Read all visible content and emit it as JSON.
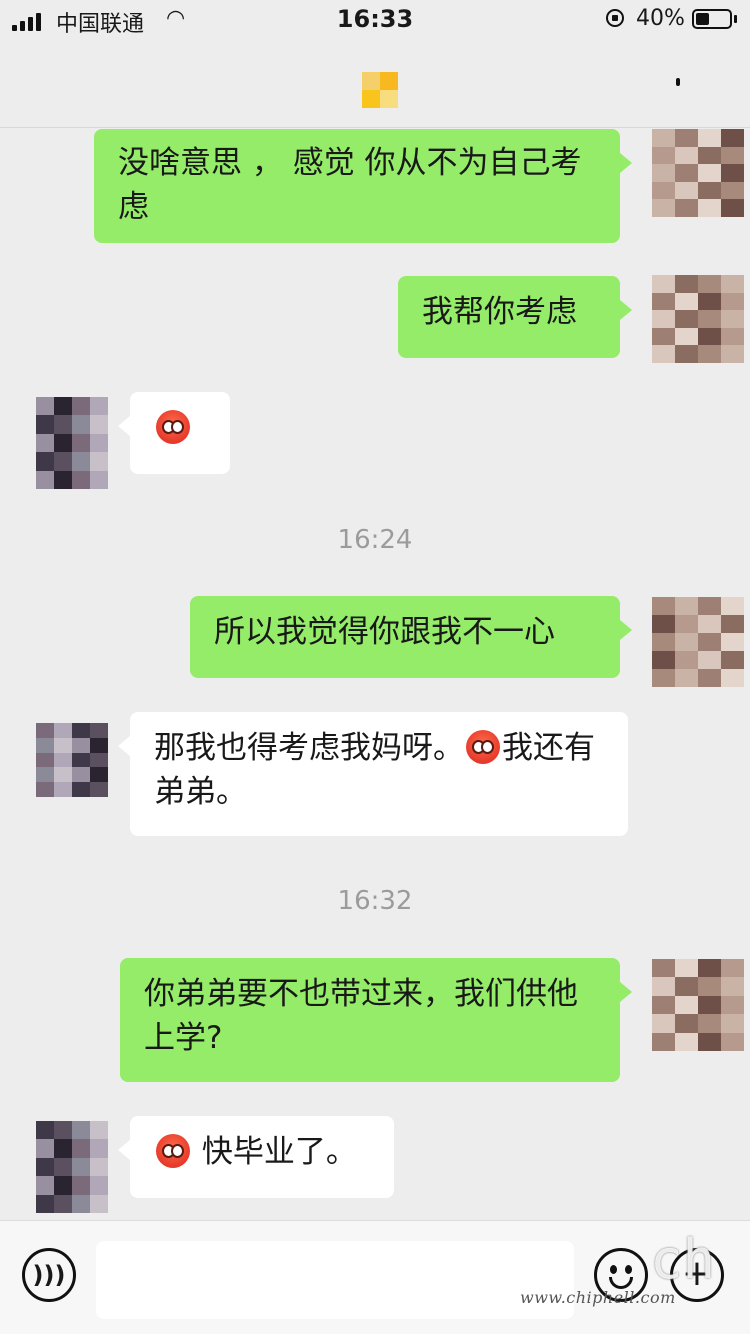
{
  "status_bar": {
    "carrier": "中国联通",
    "time": "16:33",
    "battery_percent": "40%",
    "battery_level": 0.4
  },
  "messages": [
    {
      "side": "right",
      "text": "没啥意思 ， 感觉 你从不为自己考虑"
    },
    {
      "side": "right",
      "text": "我帮你考虑"
    },
    {
      "side": "left",
      "emoji": true,
      "text": ""
    },
    {
      "type": "timestamp",
      "text": "16:24"
    },
    {
      "side": "right",
      "text": "所以我觉得你跟我不一心"
    },
    {
      "side": "left",
      "text_before": "那我也得考虑我妈呀。",
      "emoji": true,
      "text_after": "我还有弟弟。"
    },
    {
      "type": "timestamp",
      "text": "16:32"
    },
    {
      "side": "right",
      "text": "你弟弟要不也带过来，我们供他上学?"
    },
    {
      "side": "left",
      "emoji": true,
      "text_after": " 快毕业了。"
    }
  ],
  "watermark": {
    "url": "www.chiphell.com",
    "logo": "chip hell"
  },
  "icons": {
    "voice": "voice-icon",
    "emoji": "emoji-icon",
    "plus": "plus-icon",
    "emoji_inline": "blushing-face-emoji"
  },
  "colors": {
    "sent_bubble": "#95ec69",
    "received_bubble": "#ffffff",
    "background": "#ededed",
    "timestamp": "#9b9b9b"
  }
}
